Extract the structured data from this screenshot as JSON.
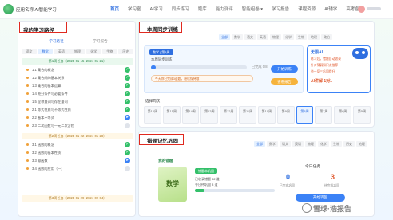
{
  "header": {
    "app_name": "应用名称 AI智能学习",
    "nav": [
      "首页",
      "学习室",
      "AI学习",
      "同步练习",
      "题库",
      "能力测评",
      "智能组卷 ▾",
      "学习报告",
      "课程资源",
      "AI辅学",
      "高考备考"
    ]
  },
  "left_panel": {
    "title": "我的学习路径",
    "tabs": [
      "学习路径",
      "学习报告"
    ],
    "chips": [
      "语文",
      "数学",
      "英语",
      "物理",
      "化学",
      "生物",
      "历史"
    ],
    "weeks": [
      {
        "label": "第1周任务（2024-01-15~2024-01-21）",
        "style": "green"
      },
      {
        "label": "第2周任务（2024-01-22~2024-01-28）",
        "style": "orange"
      },
      {
        "label": "第3周任务（2024-01-29~2024-02-04）",
        "style": "orange"
      }
    ],
    "items_week1": [
      {
        "label": "1.1 集合的概念",
        "status": "done"
      },
      {
        "label": "1.2 集合间的基本关系",
        "status": "done"
      },
      {
        "label": "1.3 集合的基本运算",
        "status": "done"
      },
      {
        "label": "1.4 充分条件与必要条件",
        "status": "done"
      },
      {
        "label": "1.5 全称量词与存在量词",
        "status": "done"
      },
      {
        "label": "2.1 等式性质与不等式性质",
        "status": "done"
      },
      {
        "label": "2.2 基本不等式",
        "status": "current"
      },
      {
        "label": "2.3 二次函数与一元二次方程",
        "status": "pending"
      }
    ],
    "items_week2": [
      {
        "label": "3.1 函数的概念",
        "status": "done"
      },
      {
        "label": "3.2 函数的基本性质",
        "status": "done"
      },
      {
        "label": "3.3 幂函数",
        "status": "current"
      },
      {
        "label": "3.4 函数的应用（一）",
        "status": "pending"
      }
    ]
  },
  "sync_panel": {
    "title": "本周同步训练",
    "chips": [
      "全部",
      "数学",
      "语文",
      "英语",
      "物理",
      "化学",
      "生物",
      "地理",
      "政治"
    ],
    "card_badge": "数学 | 第8周",
    "card_desc": "本周同步训练",
    "progress_label": "已完成 0/8",
    "progress": 0.05,
    "tip": "今天你已完成3道题，继续保持哦！",
    "btn_primary": "开始训练",
    "btn_secondary": "查看报告",
    "side_title": "无限AI",
    "side_lines": [
      "练习后，错题自动收录",
      "针对薄弱知识点推荐",
      "举一反三巩固提升",
      "AI讲解 1对1"
    ],
    "weeks_label": "选择周次",
    "weeks": [
      "第16周",
      "第15周",
      "第14周",
      "第13周",
      "第12周",
      "第11周",
      "第10周",
      "第9周",
      "第8周",
      "第7周",
      "第6周",
      "第5周"
    ],
    "active_week": 8
  },
  "practice_panel": {
    "title": "错题记忆巩固",
    "chips": [
      "全部",
      "数学",
      "语文",
      "英语",
      "物理",
      "化学",
      "生物",
      "历史",
      "地理"
    ],
    "my_label": "我的错题",
    "book_subject": "数学",
    "badge": "错题本巩固",
    "desc_1": "已收录错题 32 道",
    "desc_2": "今日待巩固 3 道",
    "progress": 0.12,
    "today_label": "今日任务",
    "stat_1_value": "0",
    "stat_1_label": "已完成巩固",
    "stat_2_value": "3",
    "stat_2_label": "待完成巩固",
    "btn": "开始巩固"
  },
  "watermark": "雪球·浩报告"
}
